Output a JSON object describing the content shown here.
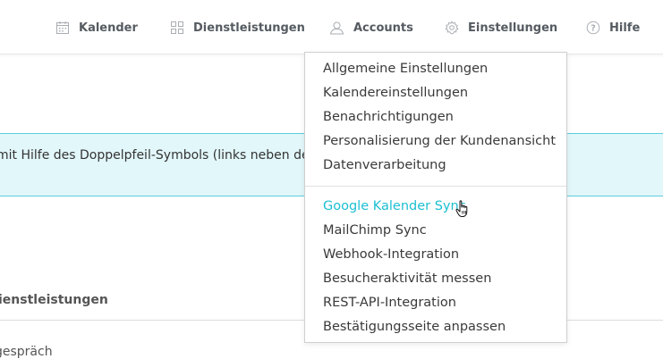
{
  "nav": {
    "items": [
      {
        "label": "Kalender",
        "icon": "calendar-icon"
      },
      {
        "label": "Dienstleistungen",
        "icon": "grid-icon"
      },
      {
        "label": "Accounts",
        "icon": "user-icon"
      },
      {
        "label": "Einstellungen",
        "icon": "gear-icon"
      },
      {
        "label": "Hilfe",
        "icon": "help-circle-icon"
      }
    ]
  },
  "banner": {
    "text": "mit Hilfe des Doppelpfeil-Symbols (links neben der                                    Position. Die Kale"
  },
  "main": {
    "section_heading": "ienstleistungen",
    "row_text": "gespräch"
  },
  "settings_menu": {
    "group1": [
      "Allgemeine Einstellungen",
      "Kalendereinstellungen",
      "Benachrichtigungen",
      "Personalisierung der Kundenansicht",
      "Datenverarbeitung"
    ],
    "group2": [
      "Google Kalender Sync",
      "MailChimp Sync",
      "Webhook-Integration",
      "Besucheraktivität messen",
      "REST-API-Integration",
      "Bestätigungsseite anpassen"
    ]
  },
  "colors": {
    "accent": "#1cbfd3",
    "banner_bg": "#e2f7fa",
    "banner_border": "#5ccddd",
    "nav_text": "#555b61"
  }
}
